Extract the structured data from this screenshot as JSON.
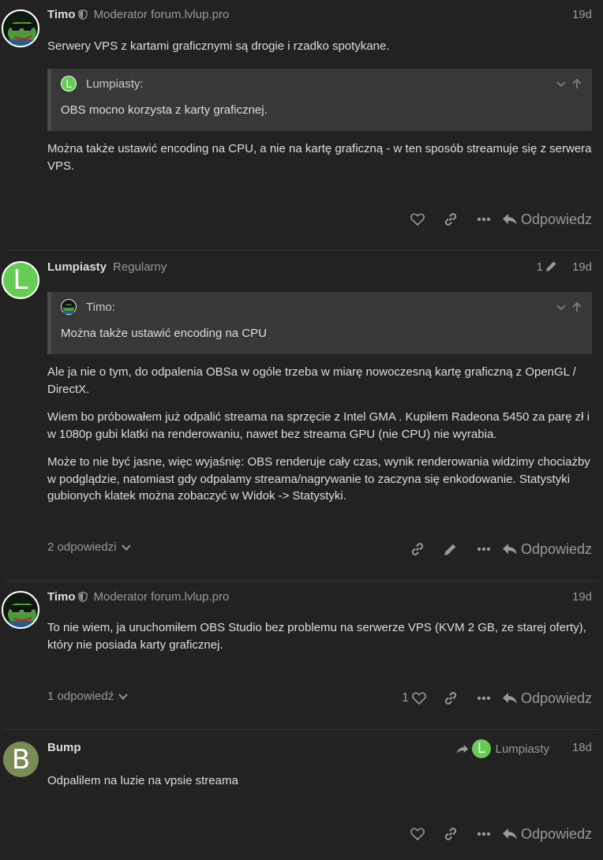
{
  "posts": [
    {
      "author": "Timo",
      "title": "Moderator forum.lvlup.pro",
      "date": "19d",
      "paragraphs": [
        "Serwery VPS z kartami graficznymi są drogie i rzadko spotykane."
      ],
      "quote": {
        "author": "Lumpiasty:",
        "text": "OBS mocno korzysta z karty graficznej."
      },
      "after_quote": [
        "Można także ustawić encoding na CPU, a nie na kartę graficzną - w ten sposób streamuje się z serwera VPS."
      ],
      "reply_label": "Odpowiedz"
    },
    {
      "author": "Lumpiasty",
      "title": "Regularny",
      "avatar_letter": "L",
      "edit_count": "1",
      "date": "19d",
      "quote": {
        "author": "Timo:",
        "text": "Można także ustawić encoding na CPU"
      },
      "paragraphs": [
        "Ale ja nie o tym, do odpalenia OBSa w ogóle trzeba w miarę nowoczesną kartę graficzną z OpenGL / DirectX.",
        "Wiem bo próbowałem już odpalić streama na sprzęcie z Intel GMA . Kupiłem Radeona 5450 za parę zł i w 1080p gubi klatki na renderowaniu, nawet bez streama GPU (nie CPU) nie wyrabia.",
        "Może to nie być jasne, więc wyjaśnię: OBS renderuje cały czas, wynik renderowania widzimy chociażby w podglądzie, natomiast gdy odpalamy streama/nagrywanie to zaczyna się enkodowanie. Statystyki gubionych klatek można zobaczyć w Widok -> Statystyki."
      ],
      "replies_toggle": "2 odpowiedzi",
      "reply_label": "Odpowiedz"
    },
    {
      "author": "Timo",
      "title": "Moderator forum.lvlup.pro",
      "date": "19d",
      "paragraphs": [
        "To nie wiem, ja uruchomiłem OBS Studio bez problemu na serwerze VPS (KVM 2 GB, ze starej oferty), który nie posiada karty graficznej."
      ],
      "replies_toggle": "1 odpowiedź",
      "like_count": "1",
      "reply_label": "Odpowiedz"
    },
    {
      "author": "Bump",
      "avatar_letter": "B",
      "reply_to": "Lumpiasty",
      "reply_to_letter": "L",
      "date": "18d",
      "paragraphs": [
        "Odpalilem na luzie na vpsie streama"
      ],
      "reply_label": "Odpowiedz"
    }
  ],
  "colors": {
    "background": "#222222",
    "accent_green": "#66cc55",
    "muted": "#999999"
  },
  "icons": [
    "shield-icon",
    "heart-icon",
    "link-icon",
    "more-icon",
    "reply-icon",
    "pencil-icon",
    "chevron-down-icon",
    "arrow-up-icon"
  ]
}
